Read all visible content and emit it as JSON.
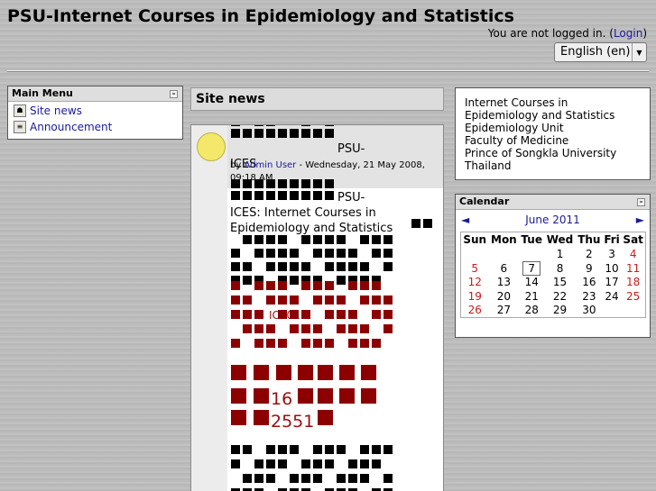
{
  "site": {
    "title": "PSU-Internet Courses in Epidemiology and Statistics"
  },
  "login": {
    "text": "You are not logged in. (",
    "link": "Login",
    "close": ")"
  },
  "language": {
    "selected": "English (en)"
  },
  "main_menu": {
    "title": "Main Menu",
    "items": [
      {
        "label": "Site news"
      },
      {
        "label": "Announcement"
      }
    ]
  },
  "site_news": {
    "title": "Site news",
    "post": {
      "title_a": "PSU-",
      "title_b": "ICES",
      "by": "by ",
      "author": "Admin User",
      "date": " - Wednesday, 21 May 2008, 09:18 AM",
      "body_a": "PSU-",
      "body_b": "ICES: Internet Courses in Epidemiology and Statistics",
      "red_label": "ICE01",
      "red_num1": "16",
      "red_num2": "2551"
    }
  },
  "info": {
    "lines": [
      "Internet Courses in",
      "Epidemiology and Statistics",
      "Epidemiology Unit",
      "Faculty of Medicine",
      "Prince of Songkla University",
      "Thailand"
    ]
  },
  "calendar": {
    "title": "Calendar",
    "prev": "◄",
    "month": "June 2011",
    "next": "►",
    "days": [
      "Sun",
      "Mon",
      "Tue",
      "Wed",
      "Thu",
      "Fri",
      "Sat"
    ],
    "weeks": [
      [
        "",
        "",
        "",
        "1",
        "2",
        "3",
        "4"
      ],
      [
        "5",
        "6",
        "7",
        "8",
        "9",
        "10",
        "11"
      ],
      [
        "12",
        "13",
        "14",
        "15",
        "16",
        "17",
        "18"
      ],
      [
        "19",
        "20",
        "21",
        "22",
        "23",
        "24",
        "25"
      ],
      [
        "26",
        "27",
        "28",
        "29",
        "30",
        "",
        ""
      ]
    ],
    "today": "7"
  }
}
